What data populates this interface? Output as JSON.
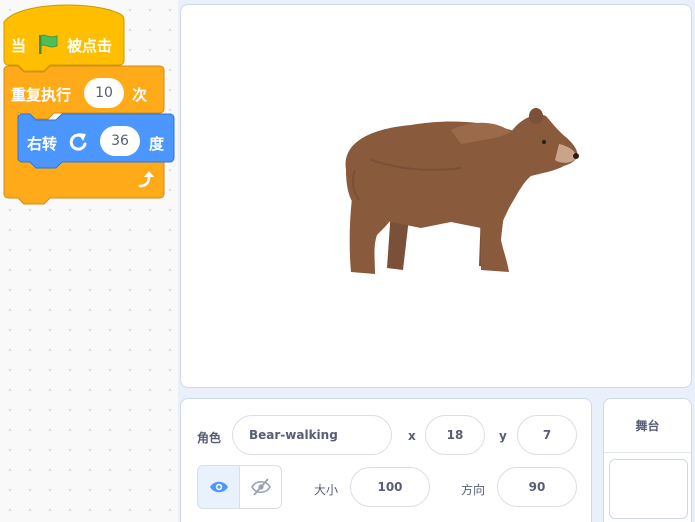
{
  "blocks": {
    "hat": {
      "prefix": "当",
      "flag_icon": "green-flag-icon",
      "suffix": "被点击",
      "color": "#FFBF00"
    },
    "repeat": {
      "label": "重复执行",
      "times": "10",
      "unit": "次",
      "color": "#FFAB19",
      "loop_icon": "loop-arrow-icon"
    },
    "turn": {
      "label": "右转",
      "direction_icon": "rotate-right-icon",
      "degrees": "36",
      "unit": "度",
      "color": "#4C97FF"
    }
  },
  "stage": {
    "sprite_image": "bear-walking-sprite"
  },
  "sprite_info": {
    "sprite_label": "角色",
    "sprite_name": "Bear-walking",
    "x_label": "x",
    "x_value": "18",
    "y_label": "y",
    "y_value": "7",
    "show_icon": "eye-icon",
    "hide_icon": "eye-slash-icon",
    "size_label": "大小",
    "size_value": "100",
    "direction_label": "方向",
    "direction_value": "90"
  },
  "stage_pane": {
    "title": "舞台"
  },
  "colors": {
    "accent": "#4C97FF",
    "border": "#CFD9EA",
    "text": "#575E75"
  }
}
